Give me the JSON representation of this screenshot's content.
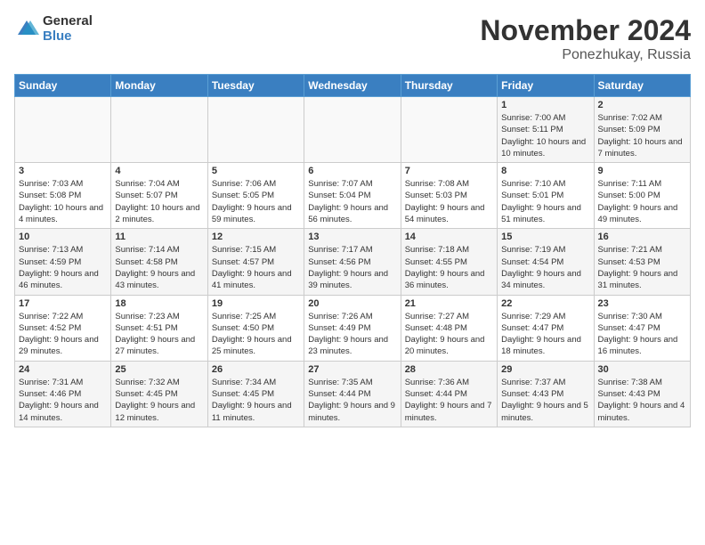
{
  "header": {
    "logo_general": "General",
    "logo_blue": "Blue",
    "month_title": "November 2024",
    "location": "Ponezhukay, Russia"
  },
  "weekdays": [
    "Sunday",
    "Monday",
    "Tuesday",
    "Wednesday",
    "Thursday",
    "Friday",
    "Saturday"
  ],
  "weeks": [
    [
      {
        "day": "",
        "info": ""
      },
      {
        "day": "",
        "info": ""
      },
      {
        "day": "",
        "info": ""
      },
      {
        "day": "",
        "info": ""
      },
      {
        "day": "",
        "info": ""
      },
      {
        "day": "1",
        "info": "Sunrise: 7:00 AM\nSunset: 5:11 PM\nDaylight: 10 hours and 10 minutes."
      },
      {
        "day": "2",
        "info": "Sunrise: 7:02 AM\nSunset: 5:09 PM\nDaylight: 10 hours and 7 minutes."
      }
    ],
    [
      {
        "day": "3",
        "info": "Sunrise: 7:03 AM\nSunset: 5:08 PM\nDaylight: 10 hours and 4 minutes."
      },
      {
        "day": "4",
        "info": "Sunrise: 7:04 AM\nSunset: 5:07 PM\nDaylight: 10 hours and 2 minutes."
      },
      {
        "day": "5",
        "info": "Sunrise: 7:06 AM\nSunset: 5:05 PM\nDaylight: 9 hours and 59 minutes."
      },
      {
        "day": "6",
        "info": "Sunrise: 7:07 AM\nSunset: 5:04 PM\nDaylight: 9 hours and 56 minutes."
      },
      {
        "day": "7",
        "info": "Sunrise: 7:08 AM\nSunset: 5:03 PM\nDaylight: 9 hours and 54 minutes."
      },
      {
        "day": "8",
        "info": "Sunrise: 7:10 AM\nSunset: 5:01 PM\nDaylight: 9 hours and 51 minutes."
      },
      {
        "day": "9",
        "info": "Sunrise: 7:11 AM\nSunset: 5:00 PM\nDaylight: 9 hours and 49 minutes."
      }
    ],
    [
      {
        "day": "10",
        "info": "Sunrise: 7:13 AM\nSunset: 4:59 PM\nDaylight: 9 hours and 46 minutes."
      },
      {
        "day": "11",
        "info": "Sunrise: 7:14 AM\nSunset: 4:58 PM\nDaylight: 9 hours and 43 minutes."
      },
      {
        "day": "12",
        "info": "Sunrise: 7:15 AM\nSunset: 4:57 PM\nDaylight: 9 hours and 41 minutes."
      },
      {
        "day": "13",
        "info": "Sunrise: 7:17 AM\nSunset: 4:56 PM\nDaylight: 9 hours and 39 minutes."
      },
      {
        "day": "14",
        "info": "Sunrise: 7:18 AM\nSunset: 4:55 PM\nDaylight: 9 hours and 36 minutes."
      },
      {
        "day": "15",
        "info": "Sunrise: 7:19 AM\nSunset: 4:54 PM\nDaylight: 9 hours and 34 minutes."
      },
      {
        "day": "16",
        "info": "Sunrise: 7:21 AM\nSunset: 4:53 PM\nDaylight: 9 hours and 31 minutes."
      }
    ],
    [
      {
        "day": "17",
        "info": "Sunrise: 7:22 AM\nSunset: 4:52 PM\nDaylight: 9 hours and 29 minutes."
      },
      {
        "day": "18",
        "info": "Sunrise: 7:23 AM\nSunset: 4:51 PM\nDaylight: 9 hours and 27 minutes."
      },
      {
        "day": "19",
        "info": "Sunrise: 7:25 AM\nSunset: 4:50 PM\nDaylight: 9 hours and 25 minutes."
      },
      {
        "day": "20",
        "info": "Sunrise: 7:26 AM\nSunset: 4:49 PM\nDaylight: 9 hours and 23 minutes."
      },
      {
        "day": "21",
        "info": "Sunrise: 7:27 AM\nSunset: 4:48 PM\nDaylight: 9 hours and 20 minutes."
      },
      {
        "day": "22",
        "info": "Sunrise: 7:29 AM\nSunset: 4:47 PM\nDaylight: 9 hours and 18 minutes."
      },
      {
        "day": "23",
        "info": "Sunrise: 7:30 AM\nSunset: 4:47 PM\nDaylight: 9 hours and 16 minutes."
      }
    ],
    [
      {
        "day": "24",
        "info": "Sunrise: 7:31 AM\nSunset: 4:46 PM\nDaylight: 9 hours and 14 minutes."
      },
      {
        "day": "25",
        "info": "Sunrise: 7:32 AM\nSunset: 4:45 PM\nDaylight: 9 hours and 12 minutes."
      },
      {
        "day": "26",
        "info": "Sunrise: 7:34 AM\nSunset: 4:45 PM\nDaylight: 9 hours and 11 minutes."
      },
      {
        "day": "27",
        "info": "Sunrise: 7:35 AM\nSunset: 4:44 PM\nDaylight: 9 hours and 9 minutes."
      },
      {
        "day": "28",
        "info": "Sunrise: 7:36 AM\nSunset: 4:44 PM\nDaylight: 9 hours and 7 minutes."
      },
      {
        "day": "29",
        "info": "Sunrise: 7:37 AM\nSunset: 4:43 PM\nDaylight: 9 hours and 5 minutes."
      },
      {
        "day": "30",
        "info": "Sunrise: 7:38 AM\nSunset: 4:43 PM\nDaylight: 9 hours and 4 minutes."
      }
    ]
  ]
}
